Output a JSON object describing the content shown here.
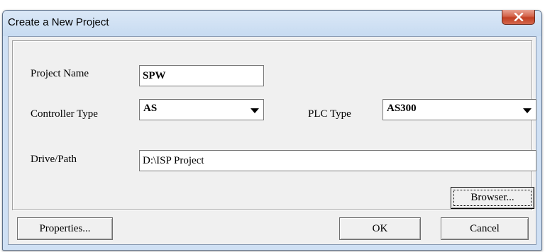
{
  "window": {
    "title": "Create a New Project",
    "close_icon": "close-icon"
  },
  "form": {
    "project_name_label": "Project Name",
    "project_name_value": "SPW",
    "controller_type_label": "Controller Type",
    "controller_type_value": "AS",
    "plc_type_label": "PLC Type",
    "plc_type_value": "AS300",
    "drive_path_label": "Drive/Path",
    "drive_path_value": "D:\\ISP Project"
  },
  "buttons": {
    "browser": "Browser...",
    "properties": "Properties...",
    "ok": "OK",
    "cancel": "Cancel"
  },
  "colors": {
    "close_button": "#c94a2e",
    "title_bar": "#cfe0f4"
  }
}
